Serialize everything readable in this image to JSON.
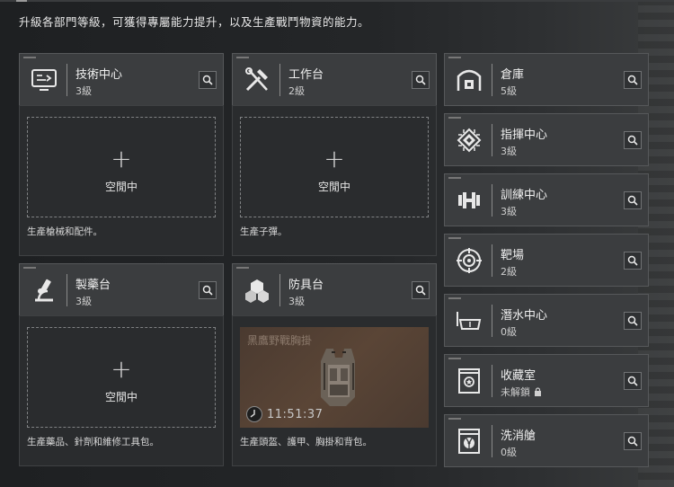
{
  "description": "升級各部門等級，可獲得專屬能力提升，以及生產戰鬥物資的能力。",
  "left_cards": [
    {
      "name": "技術中心",
      "level": "3級",
      "slot_label": "空閒中",
      "body_desc": "生產槍械和配件。"
    },
    {
      "name": "工作台",
      "level": "2級",
      "slot_label": "空閒中",
      "body_desc": "生產子彈。"
    },
    {
      "name": "製藥台",
      "level": "3級",
      "slot_label": "空閒中",
      "body_desc": "生產藥品、針劑和維修工具包。"
    },
    {
      "name": "防具台",
      "level": "3級",
      "product_name": "黑鷹野戰胸掛",
      "timer": "11:51:37",
      "body_desc": "生產頭盔、護甲、胸掛和背包。"
    }
  ],
  "right_cards": [
    {
      "name": "倉庫",
      "level": "5級",
      "icon": "warehouse-icon"
    },
    {
      "name": "指揮中心",
      "level": "3級",
      "icon": "chip-icon"
    },
    {
      "name": "訓練中心",
      "level": "3級",
      "icon": "dumbbell-icon"
    },
    {
      "name": "靶場",
      "level": "2級",
      "icon": "target-icon"
    },
    {
      "name": "潛水中心",
      "level": "0級",
      "icon": "diving-mask-icon"
    },
    {
      "name": "收藏室",
      "level": "未解鎖",
      "icon": "trophy-case-icon"
    },
    {
      "name": "洗消艙",
      "level": "0級",
      "icon": "radiation-booth-icon"
    }
  ]
}
